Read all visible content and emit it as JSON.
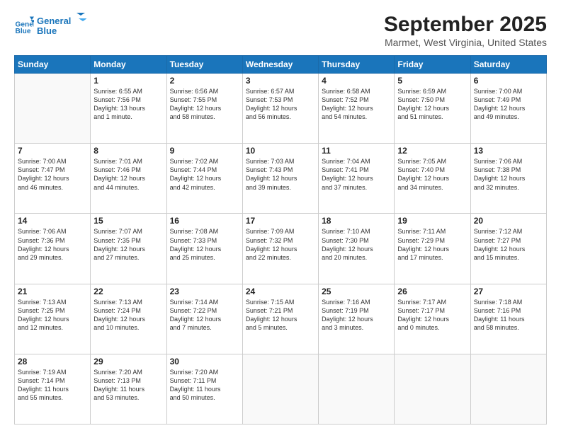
{
  "logo": {
    "line1": "General",
    "line2": "Blue"
  },
  "title": "September 2025",
  "location": "Marmet, West Virginia, United States",
  "headers": [
    "Sunday",
    "Monday",
    "Tuesday",
    "Wednesday",
    "Thursday",
    "Friday",
    "Saturday"
  ],
  "weeks": [
    [
      {
        "day": "",
        "info": ""
      },
      {
        "day": "1",
        "info": "Sunrise: 6:55 AM\nSunset: 7:56 PM\nDaylight: 13 hours\nand 1 minute."
      },
      {
        "day": "2",
        "info": "Sunrise: 6:56 AM\nSunset: 7:55 PM\nDaylight: 12 hours\nand 58 minutes."
      },
      {
        "day": "3",
        "info": "Sunrise: 6:57 AM\nSunset: 7:53 PM\nDaylight: 12 hours\nand 56 minutes."
      },
      {
        "day": "4",
        "info": "Sunrise: 6:58 AM\nSunset: 7:52 PM\nDaylight: 12 hours\nand 54 minutes."
      },
      {
        "day": "5",
        "info": "Sunrise: 6:59 AM\nSunset: 7:50 PM\nDaylight: 12 hours\nand 51 minutes."
      },
      {
        "day": "6",
        "info": "Sunrise: 7:00 AM\nSunset: 7:49 PM\nDaylight: 12 hours\nand 49 minutes."
      }
    ],
    [
      {
        "day": "7",
        "info": "Sunrise: 7:00 AM\nSunset: 7:47 PM\nDaylight: 12 hours\nand 46 minutes."
      },
      {
        "day": "8",
        "info": "Sunrise: 7:01 AM\nSunset: 7:46 PM\nDaylight: 12 hours\nand 44 minutes."
      },
      {
        "day": "9",
        "info": "Sunrise: 7:02 AM\nSunset: 7:44 PM\nDaylight: 12 hours\nand 42 minutes."
      },
      {
        "day": "10",
        "info": "Sunrise: 7:03 AM\nSunset: 7:43 PM\nDaylight: 12 hours\nand 39 minutes."
      },
      {
        "day": "11",
        "info": "Sunrise: 7:04 AM\nSunset: 7:41 PM\nDaylight: 12 hours\nand 37 minutes."
      },
      {
        "day": "12",
        "info": "Sunrise: 7:05 AM\nSunset: 7:40 PM\nDaylight: 12 hours\nand 34 minutes."
      },
      {
        "day": "13",
        "info": "Sunrise: 7:06 AM\nSunset: 7:38 PM\nDaylight: 12 hours\nand 32 minutes."
      }
    ],
    [
      {
        "day": "14",
        "info": "Sunrise: 7:06 AM\nSunset: 7:36 PM\nDaylight: 12 hours\nand 29 minutes."
      },
      {
        "day": "15",
        "info": "Sunrise: 7:07 AM\nSunset: 7:35 PM\nDaylight: 12 hours\nand 27 minutes."
      },
      {
        "day": "16",
        "info": "Sunrise: 7:08 AM\nSunset: 7:33 PM\nDaylight: 12 hours\nand 25 minutes."
      },
      {
        "day": "17",
        "info": "Sunrise: 7:09 AM\nSunset: 7:32 PM\nDaylight: 12 hours\nand 22 minutes."
      },
      {
        "day": "18",
        "info": "Sunrise: 7:10 AM\nSunset: 7:30 PM\nDaylight: 12 hours\nand 20 minutes."
      },
      {
        "day": "19",
        "info": "Sunrise: 7:11 AM\nSunset: 7:29 PM\nDaylight: 12 hours\nand 17 minutes."
      },
      {
        "day": "20",
        "info": "Sunrise: 7:12 AM\nSunset: 7:27 PM\nDaylight: 12 hours\nand 15 minutes."
      }
    ],
    [
      {
        "day": "21",
        "info": "Sunrise: 7:13 AM\nSunset: 7:25 PM\nDaylight: 12 hours\nand 12 minutes."
      },
      {
        "day": "22",
        "info": "Sunrise: 7:13 AM\nSunset: 7:24 PM\nDaylight: 12 hours\nand 10 minutes."
      },
      {
        "day": "23",
        "info": "Sunrise: 7:14 AM\nSunset: 7:22 PM\nDaylight: 12 hours\nand 7 minutes."
      },
      {
        "day": "24",
        "info": "Sunrise: 7:15 AM\nSunset: 7:21 PM\nDaylight: 12 hours\nand 5 minutes."
      },
      {
        "day": "25",
        "info": "Sunrise: 7:16 AM\nSunset: 7:19 PM\nDaylight: 12 hours\nand 3 minutes."
      },
      {
        "day": "26",
        "info": "Sunrise: 7:17 AM\nSunset: 7:17 PM\nDaylight: 12 hours\nand 0 minutes."
      },
      {
        "day": "27",
        "info": "Sunrise: 7:18 AM\nSunset: 7:16 PM\nDaylight: 11 hours\nand 58 minutes."
      }
    ],
    [
      {
        "day": "28",
        "info": "Sunrise: 7:19 AM\nSunset: 7:14 PM\nDaylight: 11 hours\nand 55 minutes."
      },
      {
        "day": "29",
        "info": "Sunrise: 7:20 AM\nSunset: 7:13 PM\nDaylight: 11 hours\nand 53 minutes."
      },
      {
        "day": "30",
        "info": "Sunrise: 7:20 AM\nSunset: 7:11 PM\nDaylight: 11 hours\nand 50 minutes."
      },
      {
        "day": "",
        "info": ""
      },
      {
        "day": "",
        "info": ""
      },
      {
        "day": "",
        "info": ""
      },
      {
        "day": "",
        "info": ""
      }
    ]
  ]
}
